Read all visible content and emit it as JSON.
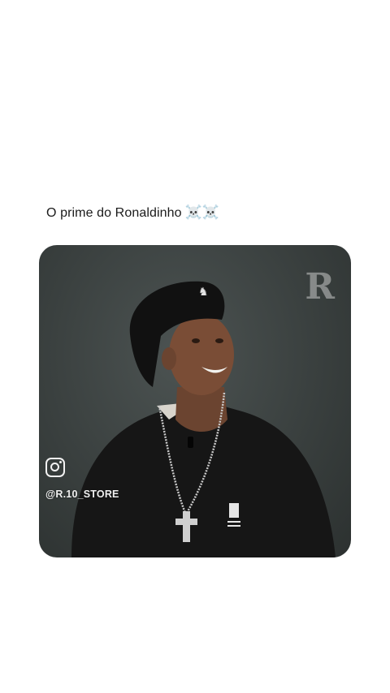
{
  "post": {
    "caption": "O prime do Ronaldinho",
    "caption_emoji": "☠️☠️"
  },
  "media": {
    "watermark_logo": "R",
    "instagram_icon": "instagram-icon",
    "instagram_handle": "@R.10_STORE",
    "hat_logo": "kangol-logo"
  },
  "colors": {
    "background": "#ffffff",
    "caption_text": "#1a1a1a",
    "media_bg": "#3a403f",
    "overlay_text": "#f0f0f0"
  }
}
